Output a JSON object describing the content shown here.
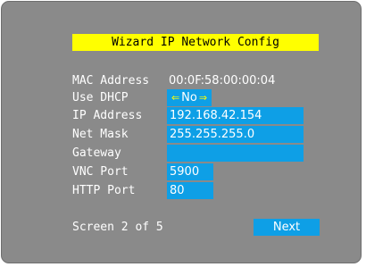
{
  "title": "Wizard IP Network Config",
  "fields": {
    "mac": {
      "label": "MAC Address",
      "value": "00:0F:58:00:00:04"
    },
    "dhcp": {
      "label": "Use DHCP",
      "value": "No",
      "left_arrow": "⇐",
      "right_arrow": "⇒"
    },
    "ip": {
      "label": "IP Address",
      "value": "192.168.42.154"
    },
    "netmask": {
      "label": "Net Mask",
      "value": "255.255.255.0"
    },
    "gateway": {
      "label": "Gateway",
      "value": ""
    },
    "vnc": {
      "label": "VNC Port",
      "value": "5900"
    },
    "http": {
      "label": "HTTP Port",
      "value": "80"
    }
  },
  "footer": {
    "screen_text": "Screen 2 of 5",
    "next_label": "Next"
  },
  "colors": {
    "background": "#8a8a8a",
    "title_bg": "#ffff00",
    "field_bg": "#0e9fe6",
    "text": "#ffffff",
    "arrow": "#ffff00"
  }
}
